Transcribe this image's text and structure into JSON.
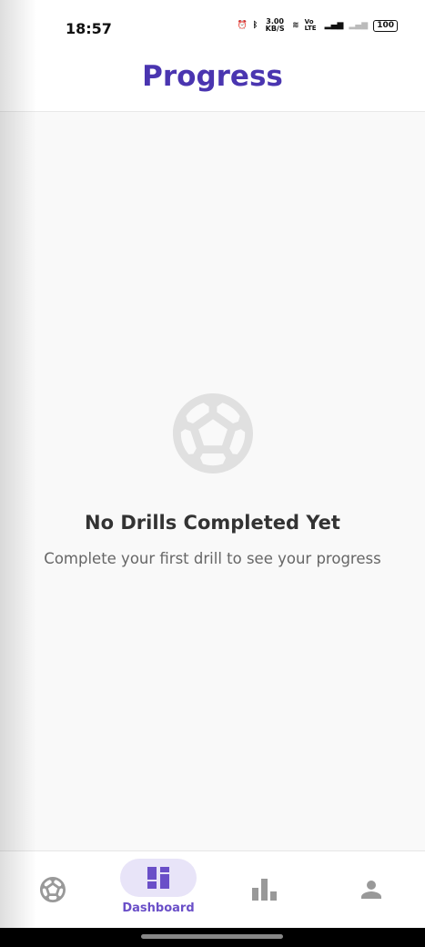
{
  "status_bar": {
    "time": "18:57",
    "net_speed": "3.00 KB/S",
    "volte": "Vo LTE",
    "battery": "100"
  },
  "header": {
    "title": "Progress"
  },
  "empty_state": {
    "icon": "soccer-ball-icon",
    "title": "No Drills Completed Yet",
    "message": "Complete your first drill to see your progress"
  },
  "bottom_nav": {
    "active": "Dashboard",
    "items": [
      {
        "icon": "soccer-ball-icon"
      },
      {
        "icon": "dashboard-icon",
        "label": "Dashboard"
      },
      {
        "icon": "bar-chart-icon"
      },
      {
        "icon": "person-icon"
      }
    ]
  },
  "colors": {
    "accent": "#4a35b0",
    "nav_active": "#6a4fc8",
    "pill": "#e8e4f8"
  }
}
